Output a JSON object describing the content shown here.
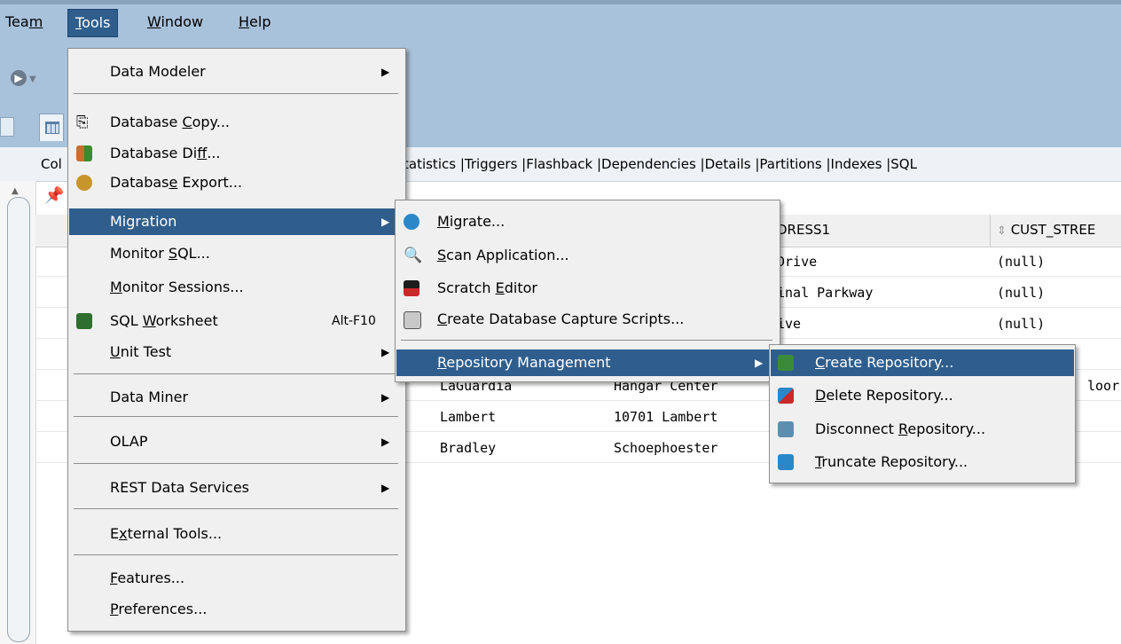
{
  "menubar": {
    "items": [
      {
        "label": "Team",
        "mn": "m"
      },
      {
        "label": "Tools",
        "mn": "T"
      },
      {
        "label": "Window",
        "mn": "W"
      },
      {
        "label": "Help",
        "mn": "H"
      }
    ]
  },
  "subtabs": {
    "first": "Col",
    "rest": "tatistics |Triggers |Flashback |Dependencies |Details |Partitions |Indexes |SQL"
  },
  "grid": {
    "headers": [
      "DRESS1",
      "CUST_STREE"
    ],
    "rows": [
      {
        "c1": "",
        "c2": "",
        "c3": "Drive",
        "c4": "(null)",
        "c5": ""
      },
      {
        "c1": "",
        "c2": "",
        "c3": "inal Parkway",
        "c4": "(null)",
        "c5": ""
      },
      {
        "c1": "",
        "c2": "",
        "c3": "ive",
        "c4": "(null)",
        "c5": ""
      },
      {
        "c1": "",
        "c2": "",
        "c3": "",
        "c4": "",
        "c5": ""
      },
      {
        "c1": "LaGuardia",
        "c2": "Hangar Center",
        "c3": "",
        "c4": "",
        "c5": "loor"
      },
      {
        "c1": "Lambert",
        "c2": "10701 Lambert",
        "c3": "",
        "c4": "",
        "c5": ""
      },
      {
        "c1": "Bradley",
        "c2": "Schoephoester",
        "c3": "",
        "c4": "",
        "c5": ""
      }
    ]
  },
  "tools_menu": {
    "items": {
      "data_modeler": "Data Modeler",
      "database_copy_a": "Database ",
      "database_copy_b": "C",
      "database_copy_c": "opy...",
      "database_diff_a": "Database Di",
      "database_diff_b": "f",
      "database_diff_c": "f...",
      "database_export_a": "Databas",
      "database_export_b": "e",
      "database_export_c": " Export...",
      "migration": "Migration",
      "monitor_sql_a": "Monitor ",
      "monitor_sql_b": "S",
      "monitor_sql_c": "QL...",
      "monitor_sessions_a": "",
      "monitor_sessions_b": "M",
      "monitor_sessions_c": "onitor Sessions...",
      "sql_worksheet_a": "SQL ",
      "sql_worksheet_b": "W",
      "sql_worksheet_c": "orksheet",
      "sql_worksheet_shortcut": "Alt-F10",
      "unit_test_a": "",
      "unit_test_b": "U",
      "unit_test_c": "nit Test",
      "data_miner": "Data Miner",
      "olap": "OLAP",
      "rest_data_services": "REST Data Services",
      "external_tools_a": "E",
      "external_tools_b": "x",
      "external_tools_c": "ternal Tools...",
      "features_a": "",
      "features_b": "F",
      "features_c": "eatures...",
      "preferences_a": "",
      "preferences_b": "P",
      "preferences_c": "references..."
    }
  },
  "migration_menu": {
    "migrate_a": "",
    "migrate_b": "M",
    "migrate_c": "igrate...",
    "scan_a": "",
    "scan_b": "S",
    "scan_c": "can Application...",
    "scratch_a": "Scratch ",
    "scratch_b": "E",
    "scratch_c": "ditor",
    "capture_a": "",
    "capture_b": "C",
    "capture_c": "reate Database Capture Scripts...",
    "repo_a": "",
    "repo_b": "R",
    "repo_c": "epository Management"
  },
  "repository_menu": {
    "create_a": "",
    "create_b": "C",
    "create_c": "reate Repository...",
    "delete_a": "",
    "delete_b": "D",
    "delete_c": "elete Repository...",
    "disconnect_a": "Disconnect ",
    "disconnect_b": "R",
    "disconnect_c": "epository...",
    "truncate_a": "",
    "truncate_b": "T",
    "truncate_c": "runcate Repository..."
  },
  "colors": {
    "chrome": "#a9c2db",
    "highlight": "#2f5e8d",
    "menu_bg": "#f0f0f0"
  }
}
